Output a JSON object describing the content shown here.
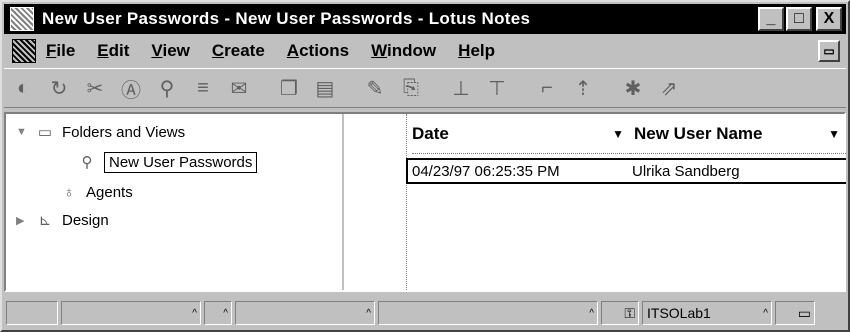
{
  "window": {
    "title": "New User Passwords - New User Passwords - Lotus Notes",
    "minimize_label": "_",
    "maximize_label": "□",
    "close_label": "X"
  },
  "menu": {
    "items": [
      {
        "label": "File"
      },
      {
        "label": "Edit"
      },
      {
        "label": "View"
      },
      {
        "label": "Create"
      },
      {
        "label": "Actions"
      },
      {
        "label": "Window"
      },
      {
        "label": "Help"
      }
    ]
  },
  "toolbar": {
    "icons": [
      "back-icon",
      "forward-icon",
      "cut-icon",
      "text-icon",
      "search-icon",
      "mail-icon",
      "send-icon",
      "copy-icon",
      "paste-icon",
      "edit-icon",
      "attach-icon",
      "collapse-icon",
      "expand-icon",
      "up-icon",
      "next-icon",
      "categorize-icon",
      "next-unread-icon"
    ]
  },
  "navigator": {
    "folders_label": "Folders and Views",
    "view_label": "New User Passwords",
    "agents_label": "Agents",
    "design_label": "Design"
  },
  "view": {
    "columns": [
      {
        "label": "Date"
      },
      {
        "label": "New User Name"
      }
    ],
    "rows": [
      {
        "date": "04/23/97 06:25:35 PM",
        "name": "Ulrika Sandberg"
      }
    ]
  },
  "statusbar": {
    "server": "ITSOLab1"
  },
  "colors": {
    "titlebar": "#000000",
    "face": "#c0c0c0",
    "pane": "#ffffff"
  }
}
